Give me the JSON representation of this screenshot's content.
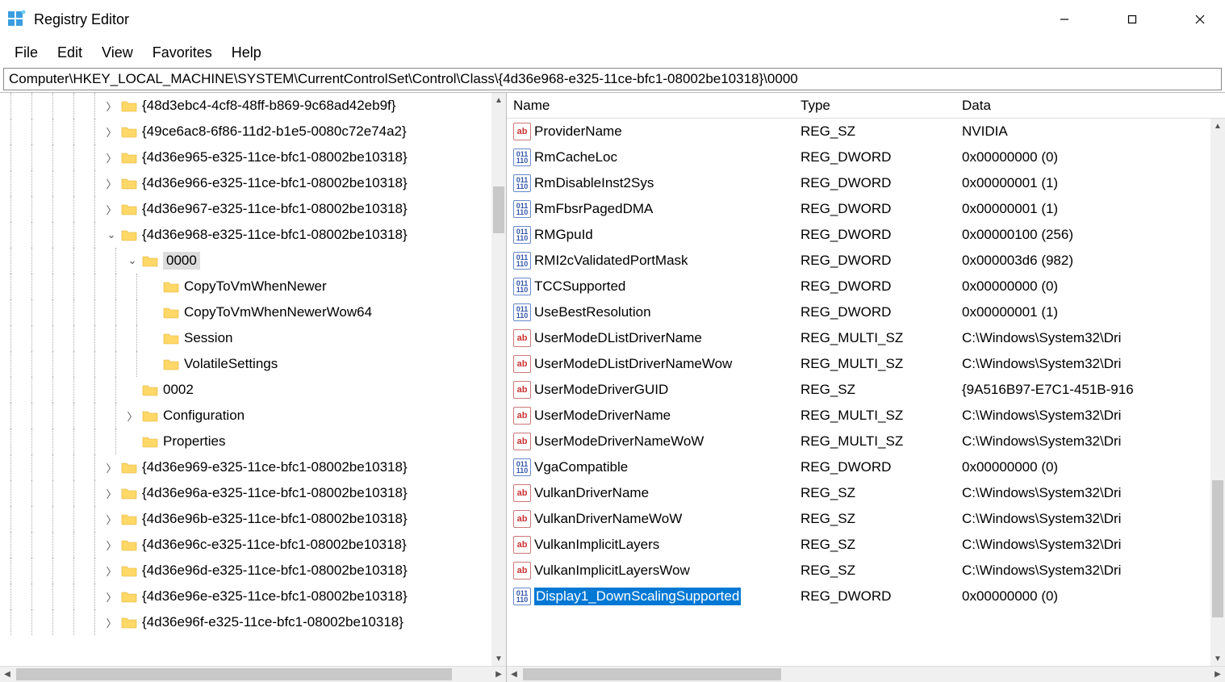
{
  "window": {
    "title": "Registry Editor"
  },
  "menu": {
    "file": "File",
    "edit": "Edit",
    "view": "View",
    "favorites": "Favorites",
    "help": "Help"
  },
  "address": "Computer\\HKEY_LOCAL_MACHINE\\SYSTEM\\CurrentControlSet\\Control\\Class\\{4d36e968-e325-11ce-bfc1-08002be10318}\\0000",
  "tree": [
    {
      "depth": 5,
      "exp": "closed",
      "label": "{48d3ebc4-4cf8-48ff-b869-9c68ad42eb9f}"
    },
    {
      "depth": 5,
      "exp": "closed",
      "label": "{49ce6ac8-6f86-11d2-b1e5-0080c72e74a2}"
    },
    {
      "depth": 5,
      "exp": "closed",
      "label": "{4d36e965-e325-11ce-bfc1-08002be10318}"
    },
    {
      "depth": 5,
      "exp": "closed",
      "label": "{4d36e966-e325-11ce-bfc1-08002be10318}"
    },
    {
      "depth": 5,
      "exp": "closed",
      "label": "{4d36e967-e325-11ce-bfc1-08002be10318}"
    },
    {
      "depth": 5,
      "exp": "open",
      "label": "{4d36e968-e325-11ce-bfc1-08002be10318}"
    },
    {
      "depth": 6,
      "exp": "open",
      "label": "0000",
      "selected": true
    },
    {
      "depth": 7,
      "exp": "none",
      "label": "CopyToVmWhenNewer"
    },
    {
      "depth": 7,
      "exp": "none",
      "label": "CopyToVmWhenNewerWow64"
    },
    {
      "depth": 7,
      "exp": "none",
      "label": "Session"
    },
    {
      "depth": 7,
      "exp": "none",
      "label": "VolatileSettings"
    },
    {
      "depth": 6,
      "exp": "none",
      "label": "0002"
    },
    {
      "depth": 6,
      "exp": "closed",
      "label": "Configuration"
    },
    {
      "depth": 6,
      "exp": "none",
      "label": "Properties"
    },
    {
      "depth": 5,
      "exp": "closed",
      "label": "{4d36e969-e325-11ce-bfc1-08002be10318}"
    },
    {
      "depth": 5,
      "exp": "closed",
      "label": "{4d36e96a-e325-11ce-bfc1-08002be10318}"
    },
    {
      "depth": 5,
      "exp": "closed",
      "label": "{4d36e96b-e325-11ce-bfc1-08002be10318}"
    },
    {
      "depth": 5,
      "exp": "closed",
      "label": "{4d36e96c-e325-11ce-bfc1-08002be10318}"
    },
    {
      "depth": 5,
      "exp": "closed",
      "label": "{4d36e96d-e325-11ce-bfc1-08002be10318}"
    },
    {
      "depth": 5,
      "exp": "closed",
      "label": "{4d36e96e-e325-11ce-bfc1-08002be10318}"
    },
    {
      "depth": 5,
      "exp": "closed",
      "label": "{4d36e96f-e325-11ce-bfc1-08002be10318}"
    }
  ],
  "columns": {
    "name": "Name",
    "type": "Type",
    "data": "Data"
  },
  "values": [
    {
      "icon": "str",
      "name": "ProviderName",
      "type": "REG_SZ",
      "data": "NVIDIA"
    },
    {
      "icon": "bin",
      "name": "RmCacheLoc",
      "type": "REG_DWORD",
      "data": "0x00000000 (0)"
    },
    {
      "icon": "bin",
      "name": "RmDisableInst2Sys",
      "type": "REG_DWORD",
      "data": "0x00000001 (1)"
    },
    {
      "icon": "bin",
      "name": "RmFbsrPagedDMA",
      "type": "REG_DWORD",
      "data": "0x00000001 (1)"
    },
    {
      "icon": "bin",
      "name": "RMGpuId",
      "type": "REG_DWORD",
      "data": "0x00000100 (256)"
    },
    {
      "icon": "bin",
      "name": "RMI2cValidatedPortMask",
      "type": "REG_DWORD",
      "data": "0x000003d6 (982)"
    },
    {
      "icon": "bin",
      "name": "TCCSupported",
      "type": "REG_DWORD",
      "data": "0x00000000 (0)"
    },
    {
      "icon": "bin",
      "name": "UseBestResolution",
      "type": "REG_DWORD",
      "data": "0x00000001 (1)"
    },
    {
      "icon": "str",
      "name": "UserModeDListDriverName",
      "type": "REG_MULTI_SZ",
      "data": "C:\\Windows\\System32\\Dri"
    },
    {
      "icon": "str",
      "name": "UserModeDListDriverNameWow",
      "type": "REG_MULTI_SZ",
      "data": "C:\\Windows\\System32\\Dri"
    },
    {
      "icon": "str",
      "name": "UserModeDriverGUID",
      "type": "REG_SZ",
      "data": "{9A516B97-E7C1-451B-916"
    },
    {
      "icon": "str",
      "name": "UserModeDriverName",
      "type": "REG_MULTI_SZ",
      "data": "C:\\Windows\\System32\\Dri"
    },
    {
      "icon": "str",
      "name": "UserModeDriverNameWoW",
      "type": "REG_MULTI_SZ",
      "data": "C:\\Windows\\System32\\Dri"
    },
    {
      "icon": "bin",
      "name": "VgaCompatible",
      "type": "REG_DWORD",
      "data": "0x00000000 (0)"
    },
    {
      "icon": "str",
      "name": "VulkanDriverName",
      "type": "REG_SZ",
      "data": "C:\\Windows\\System32\\Dri"
    },
    {
      "icon": "str",
      "name": "VulkanDriverNameWoW",
      "type": "REG_SZ",
      "data": "C:\\Windows\\System32\\Dri"
    },
    {
      "icon": "str",
      "name": "VulkanImplicitLayers",
      "type": "REG_SZ",
      "data": "C:\\Windows\\System32\\Dri"
    },
    {
      "icon": "str",
      "name": "VulkanImplicitLayersWow",
      "type": "REG_SZ",
      "data": "C:\\Windows\\System32\\Dri"
    },
    {
      "icon": "bin",
      "name": "Display1_DownScalingSupported",
      "type": "REG_DWORD",
      "data": "0x00000000 (0)",
      "selected": true
    }
  ]
}
